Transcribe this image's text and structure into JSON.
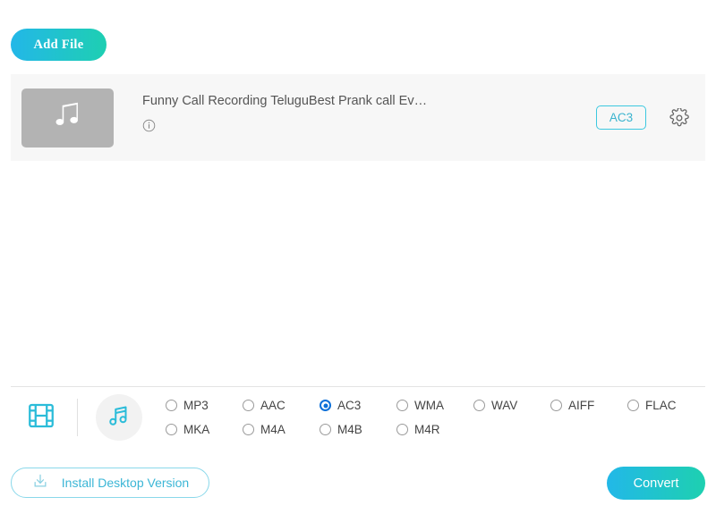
{
  "toolbar": {
    "add_file_label": "Add File"
  },
  "file_row": {
    "thumbnail_icon": "music-note-icon",
    "file_name": "Funny Call Recording TeluguBest Prank call Ev…",
    "info_icon": "info-circle-icon",
    "output_format_badge": "AC3",
    "settings_icon": "gear-icon"
  },
  "format_bar": {
    "video_tab_icon": "film-strip-icon",
    "audio_tab_icon": "music-note-icon",
    "active_tab": "audio",
    "selected_format": "AC3",
    "options": [
      {
        "label": "MP3",
        "selected": false
      },
      {
        "label": "AAC",
        "selected": false
      },
      {
        "label": "AC3",
        "selected": true
      },
      {
        "label": "WMA",
        "selected": false
      },
      {
        "label": "WAV",
        "selected": false
      },
      {
        "label": "AIFF",
        "selected": false
      },
      {
        "label": "FLAC",
        "selected": false
      },
      {
        "label": "MKA",
        "selected": false
      },
      {
        "label": "M4A",
        "selected": false
      },
      {
        "label": "M4B",
        "selected": false
      },
      {
        "label": "M4R",
        "selected": false
      }
    ]
  },
  "footer": {
    "install_label": "Install Desktop Version",
    "install_icon": "download-icon",
    "convert_label": "Convert"
  },
  "colors": {
    "accent_cyan": "#23b7e8",
    "accent_teal": "#1ecfb2",
    "badge_border": "#3cc8e0",
    "radio_selected": "#0b6fd8",
    "panel_bg": "#f7f7f7",
    "thumb_bg": "#b3b3b3"
  }
}
